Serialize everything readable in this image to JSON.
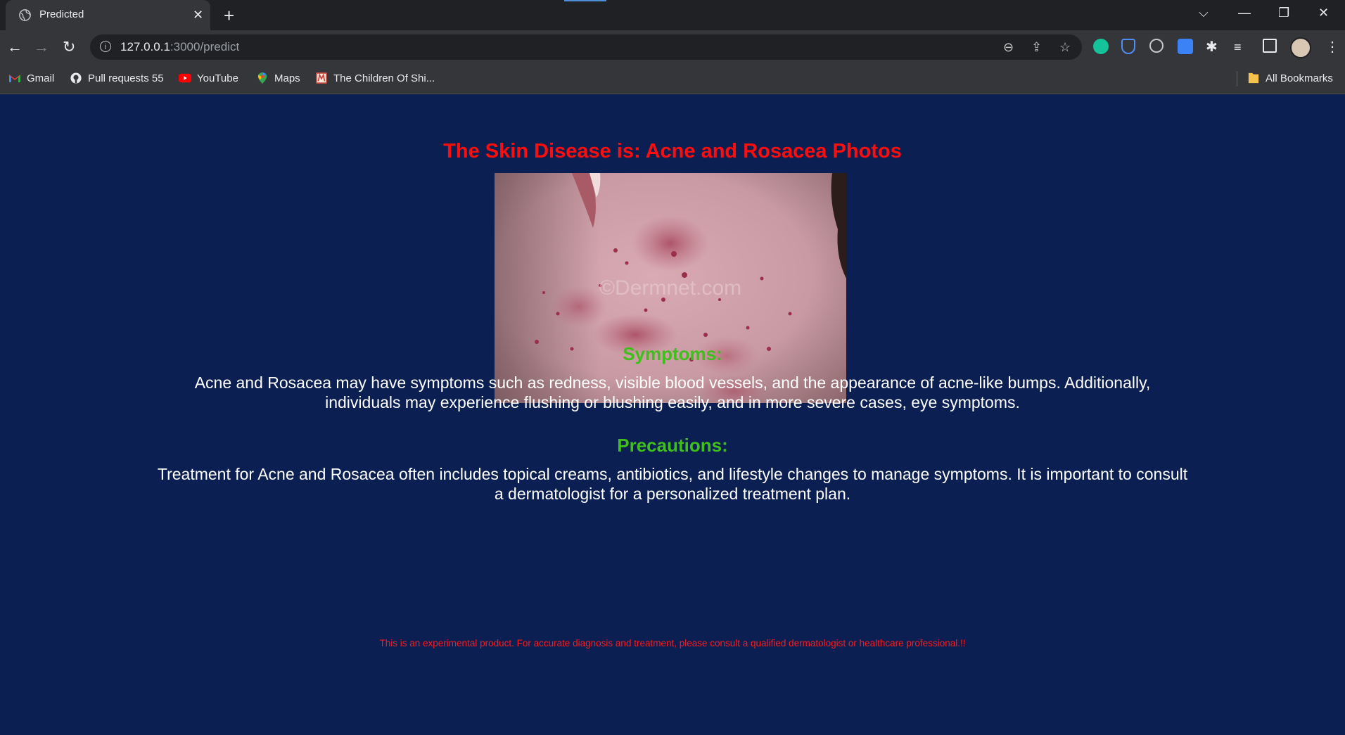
{
  "browser": {
    "tab_title": "Predicted",
    "url_host": "127.0.0.1",
    "url_path": ":3000/predict",
    "bookmarks": [
      {
        "label": "Gmail",
        "icon": "gmail-icon"
      },
      {
        "label": "Pull requests 55",
        "icon": "github-icon"
      },
      {
        "label": "YouTube",
        "icon": "youtube-icon"
      },
      {
        "label": "Maps",
        "icon": "maps-icon"
      },
      {
        "label": "The Children Of Shi...",
        "icon": "site-icon"
      }
    ],
    "all_bookmarks": "All Bookmarks"
  },
  "result": {
    "title": "The Skin Disease is: Acne and Rosacea Photos",
    "image_watermark": "©Dermnet.com",
    "symptoms_heading": "Symptoms:",
    "symptoms_text": "Acne and Rosacea may have symptoms such as redness, visible blood vessels, and the appearance of acne-like bumps. Additionally, individuals may experience flushing or blushing easily, and in more severe cases, eye symptoms.",
    "precautions_heading": "Precautions:",
    "precautions_text": "Treatment for Acne and Rosacea often includes topical creams, antibiotics, and lifestyle changes to manage symptoms. It is important to consult a dermatologist for a personalized treatment plan.",
    "disclaimer": "This is an experimental product. For accurate diagnosis and treatment, please consult a qualified dermatologist or healthcare professional.!!"
  },
  "colors": {
    "page_background": "#0b1f52",
    "title": "#ff0d0d",
    "heading": "#3fbf19",
    "body_text": "#ffffff",
    "disclaimer": "#ff1a1a"
  }
}
